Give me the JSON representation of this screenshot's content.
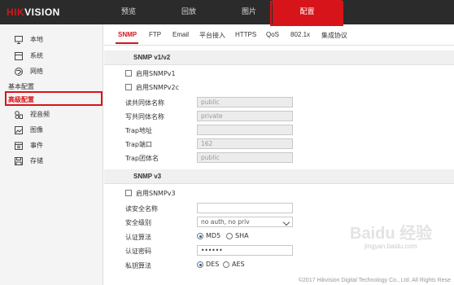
{
  "brand": {
    "logo_prefix": "HIK",
    "logo_suffix": "VISION"
  },
  "topnav": {
    "preview": "预览",
    "playback": "回放",
    "picture": "图片",
    "config": "配置"
  },
  "sidebar": {
    "local": "本地",
    "system": "系统",
    "network": "网络",
    "basic": "基本配置",
    "advanced": "高级配置",
    "video_audio": "视音频",
    "image": "图像",
    "event": "事件",
    "storage": "存储"
  },
  "tabs": {
    "snmp": "SNMP",
    "ftp": "FTP",
    "email": "Email",
    "platform": "平台接入",
    "https": "HTTPS",
    "qos": "QoS",
    "dot1x": "802.1x",
    "integration": "集成协议"
  },
  "v12": {
    "title": "SNMP v1/v2",
    "enable_v1": "启用SNMPv1",
    "enable_v2c": "启用SNMPv2c",
    "read_community_label": "读共同体名称",
    "read_community_value": "public",
    "write_community_label": "写共同体名称",
    "write_community_value": "private",
    "trap_address_label": "Trap地址",
    "trap_address_value": "",
    "trap_port_label": "Trap端口",
    "trap_port_value": "162",
    "trap_community_label": "Trap团体名",
    "trap_community_value": "public"
  },
  "v3": {
    "title": "SNMP v3",
    "enable_v3": "启用SNMPv3",
    "read_security_label": "读安全名称",
    "read_security_value": "",
    "security_level_label": "安全级别",
    "security_level_value": "no auth, no priv",
    "auth_algo_label": "认证算法",
    "auth_md5": "MD5",
    "auth_sha": "SHA",
    "auth_password_label": "认证密码",
    "auth_password_value": "••••••",
    "priv_algo_label": "私钥算法",
    "priv_des": "DES",
    "priv_aes": "AES"
  },
  "footer": "©2017 Hikvision Digital Technology Co., Ltd. All Rights Rese",
  "watermark": {
    "main": "Baidu 经验",
    "sub": "jingyan.baidu.com"
  },
  "colors": {
    "accent": "#d7141a",
    "topbar": "#2b2b2b"
  }
}
